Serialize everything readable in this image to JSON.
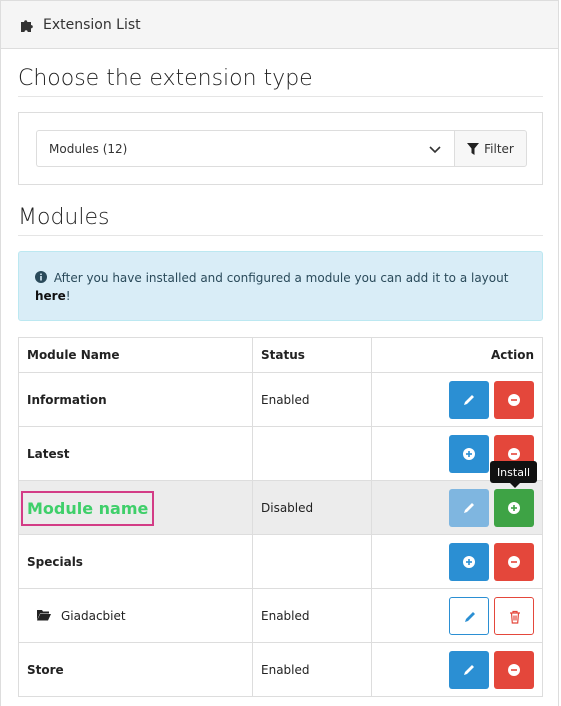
{
  "header": {
    "title": "Extension List",
    "icon": "puzzle-icon"
  },
  "choose": {
    "heading": "Choose the extension type",
    "select_value": "Modules (12)",
    "filter_label": "Filter"
  },
  "modules": {
    "heading": "Modules",
    "alert_text": "After you have installed and configured a module you can add it to a layout",
    "alert_link": "here",
    "alert_end": "!"
  },
  "table": {
    "headers": [
      "Module Name",
      "Status",
      "Action"
    ],
    "rows": [
      {
        "name": "Information",
        "status": "Enabled",
        "actions": [
          "edit-primary",
          "uninstall"
        ]
      },
      {
        "name": "Latest",
        "status": "",
        "actions": [
          "install-primary",
          "uninstall"
        ]
      },
      {
        "name": "",
        "status": "Disabled",
        "actions": [
          "edit-disabled",
          "install-success"
        ]
      },
      {
        "name": "Specials",
        "status": "",
        "actions": [
          "install-primary",
          "uninstall"
        ]
      },
      {
        "name": "Giadacbiet",
        "status": "Enabled",
        "actions": [
          "edit-outline",
          "delete-outline"
        ]
      },
      {
        "name": "Store",
        "status": "Enabled",
        "actions": [
          "edit-primary",
          "uninstall"
        ]
      }
    ]
  },
  "annotation_label": "Module name",
  "tooltip": "Install",
  "colors": {
    "primary": "#2b8fd3",
    "danger": "#e4473b",
    "success": "#3ea345",
    "info_bg": "#d9edf7",
    "annotation_border": "#d33c86",
    "annotation_text": "#3fcf6a"
  }
}
